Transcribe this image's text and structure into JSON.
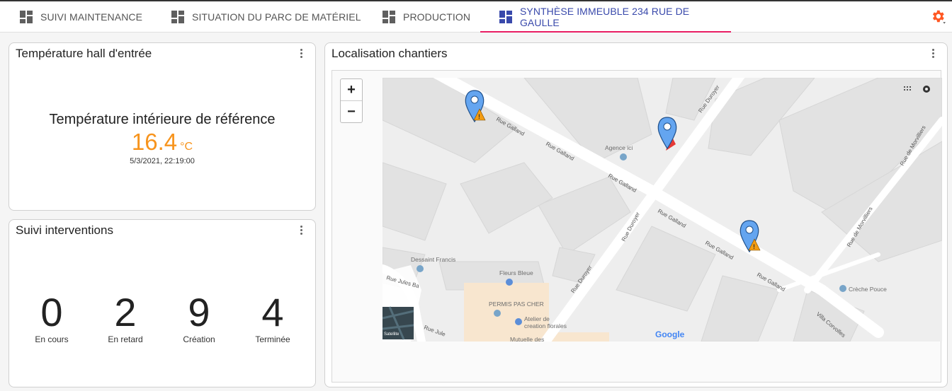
{
  "tabs": [
    {
      "label": "SUIVI MAINTENANCE",
      "active": false
    },
    {
      "label": "SITUATION DU PARC DE MATÉRIEL",
      "active": false
    },
    {
      "label": "PRODUCTION",
      "active": false
    },
    {
      "label": "SYNTHÈSE IMMEUBLE 234 RUE DE GAULLE",
      "active": true
    }
  ],
  "colors": {
    "accent": "#3949ab",
    "tab_indicator": "#e91e63",
    "temperature": "#f7941d",
    "gear": "#ff5722"
  },
  "temperature_card": {
    "title": "Température hall d'entrée",
    "label": "Température intérieure de référence",
    "value": "16.4",
    "unit": "°C",
    "timestamp": "5/3/2021, 22:19:00"
  },
  "interventions_card": {
    "title": "Suivi interventions",
    "stats": [
      {
        "value": "0",
        "label": "En cours"
      },
      {
        "value": "2",
        "label": "En retard"
      },
      {
        "value": "9",
        "label": "Création"
      },
      {
        "value": "4",
        "label": "Terminée"
      }
    ]
  },
  "map_card": {
    "title": "Localisation chantiers",
    "zoom_in": "+",
    "zoom_out": "−",
    "streets": {
      "galland": "Rue Galland",
      "duroyer": "Rue Duroyer",
      "morvilliers": "Rue de Morvilliers",
      "jules": "Rue Jules Ba",
      "jules2": "Rue Jule",
      "corvolles": "Villa Corvolles"
    },
    "places": {
      "agence": "Agence ici",
      "dessaint": "Dessaint Francis",
      "fleurs": "Fleurs Bleue",
      "permis": "PERMIS PAS CHER",
      "atelier1": "Atelier de",
      "atelier2": "creation florales",
      "creche": "Crèche Pouce",
      "mutuelle": "Mutuelle des"
    },
    "satellite_label": "Satellite",
    "google_logo": "Google",
    "markers": [
      {
        "type": "blue-warning"
      },
      {
        "type": "blue-red"
      },
      {
        "type": "blue-warning"
      }
    ]
  }
}
